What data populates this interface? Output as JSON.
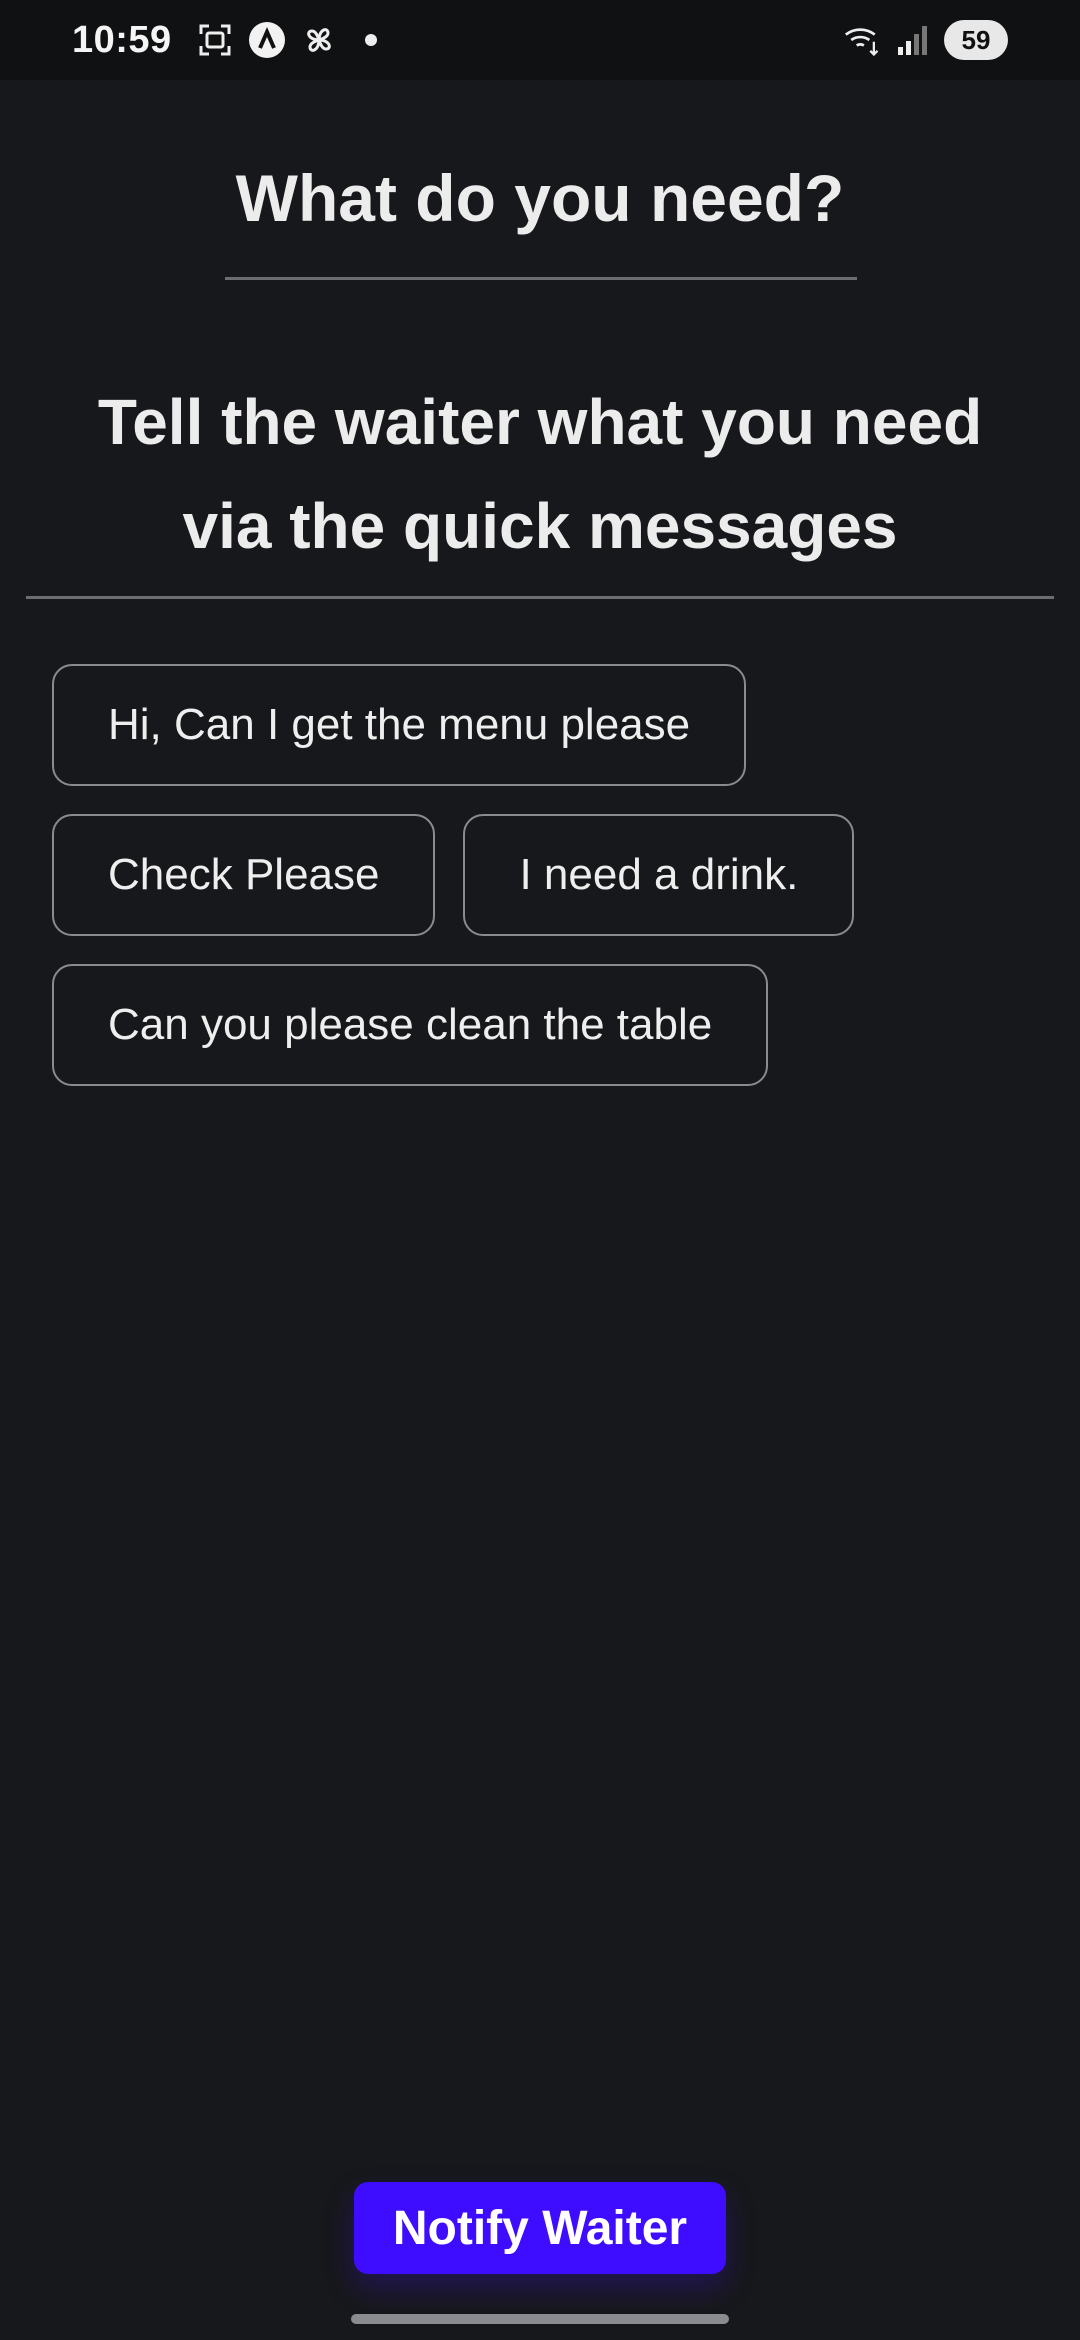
{
  "status_bar": {
    "time": "10:59",
    "battery_level": "59",
    "icons": [
      "screenshot-icon",
      "app-a-icon",
      "pinwheel-icon",
      "dot-icon",
      "wifi-icon",
      "signal-icon"
    ]
  },
  "header": {
    "title": "What do you need?"
  },
  "instructions": {
    "line1": "Tell the waiter what you need",
    "line2": "via the quick messages"
  },
  "quick_messages": [
    "Hi, Can I get the menu please",
    "Check Please",
    "I need a drink.",
    "Can you please clean the table"
  ],
  "actions": {
    "notify_label": "Notify Waiter"
  },
  "colors": {
    "background": "#17181b",
    "accent": "#3e0cff",
    "chip_border": "#8a8b8e"
  }
}
